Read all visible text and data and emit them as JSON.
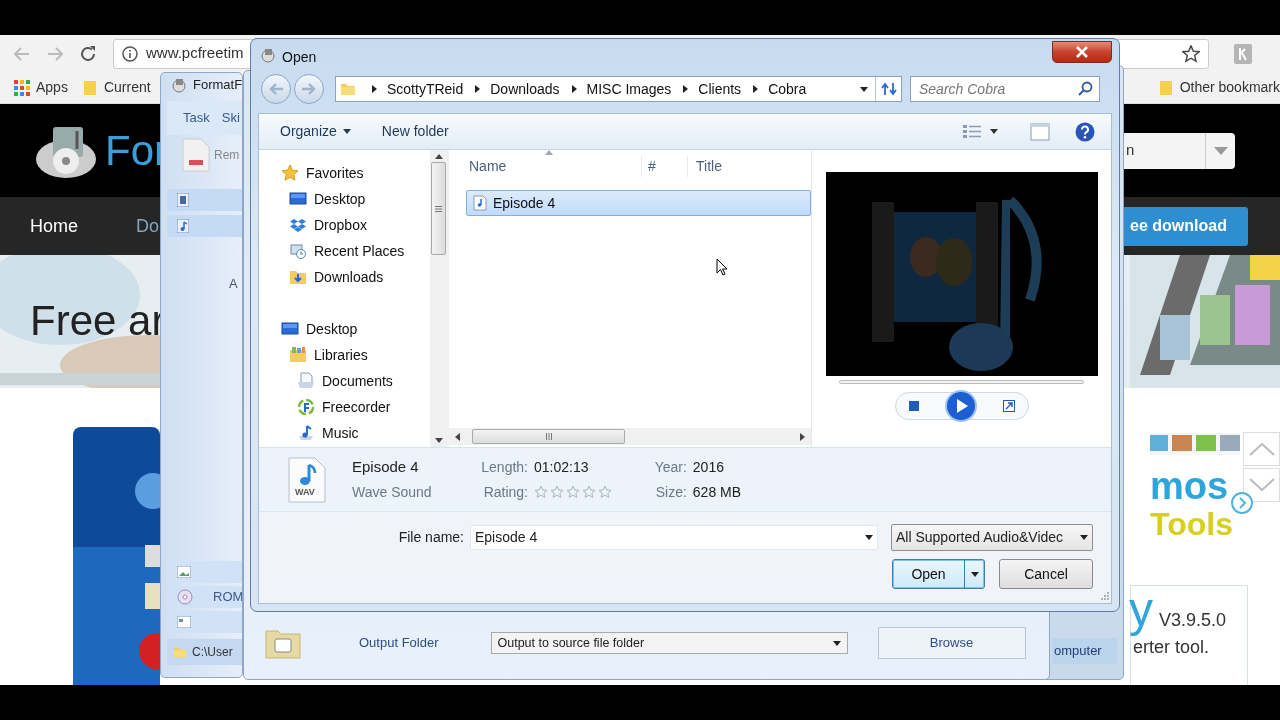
{
  "browser": {
    "url": "www.pcfreetim",
    "bookmarks": [
      {
        "label": "Apps",
        "kind": "apps"
      },
      {
        "label": "Current",
        "kind": "folder"
      }
    ],
    "other_bookmarks": "Other bookmark"
  },
  "website": {
    "logo": "For",
    "search_select": "n",
    "nav": [
      "Home",
      "Do"
    ],
    "download_button": "ee download",
    "banner_heading": "Free ar",
    "promo_title": "mos",
    "promo_subtitle": "Tools",
    "product_initial": "y",
    "version": "V3.9.5.0",
    "tagline": "erter tool."
  },
  "format_factory": {
    "title": "FormatF",
    "menu": [
      "Task",
      "Ski"
    ],
    "remove_label": "Rem",
    "hint": "A",
    "rom_label": "ROM",
    "path": "C:\\User"
  },
  "conversion_panel": {
    "output_label": "Output Folder",
    "output_option": "Output to source file folder",
    "browse_button": "Browse"
  },
  "side_window": {
    "label": "omputer"
  },
  "dialog": {
    "title": "Open",
    "path": [
      "ScottyTReid",
      "Downloads",
      "MISC Images",
      "Clients",
      "Cobra"
    ],
    "search_placeholder": "Search Cobra",
    "toolbar": [
      "Organize",
      "New folder"
    ],
    "navigation": [
      {
        "label": "Favorites",
        "kind": "favorites",
        "children": [
          {
            "label": "Desktop",
            "kind": "desktop"
          },
          {
            "label": "Dropbox",
            "kind": "dropbox"
          },
          {
            "label": "Recent Places",
            "kind": "recent"
          },
          {
            "label": "Downloads",
            "kind": "downloads"
          }
        ]
      },
      {
        "label": "Desktop",
        "kind": "desktop",
        "children": [
          {
            "label": "Libraries",
            "kind": "libraries",
            "children": [
              {
                "label": "Documents",
                "kind": "documents"
              },
              {
                "label": "Freecorder",
                "kind": "freecorder"
              },
              {
                "label": "Music",
                "kind": "music"
              }
            ]
          }
        ]
      }
    ],
    "columns": [
      "Name",
      "#",
      "Title"
    ],
    "files": [
      {
        "name": "Episode 4",
        "selected": true
      }
    ],
    "details": {
      "name": "Episode 4",
      "type": "Wave Sound",
      "icon_label": "WAV",
      "property_columns": [
        [
          {
            "label": "Length:",
            "value": "01:02:13"
          },
          {
            "label": "Rating:",
            "stars": 0
          }
        ],
        [
          {
            "label": "Year:",
            "value": "2016"
          },
          {
            "label": "Size:",
            "value": "628 MB"
          }
        ]
      ]
    },
    "file_name_label": "File name:",
    "file_name": "Episode 4",
    "file_type": "All Supported Audio&Videc",
    "buttons": [
      {
        "label": "Open",
        "kind": "split",
        "default": true
      },
      {
        "label": "Cancel",
        "kind": "plain",
        "default": false
      }
    ]
  }
}
